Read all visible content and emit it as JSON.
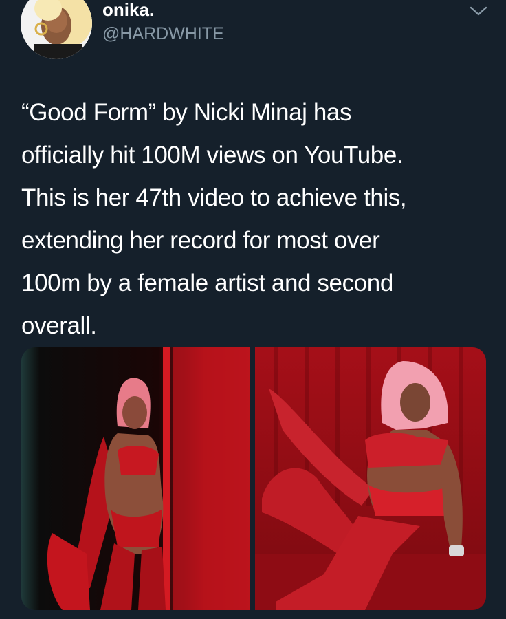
{
  "tweet": {
    "display_name": "onika.",
    "handle": "@HARDWHITE",
    "text": "“Good Form” by Nicki Minaj has\nofficially hit 100M views on YouTube.\nThis is her 47th video to achieve this,\nextending her record for most over\n100m by a female artist and second\noverall."
  },
  "icons": {
    "menu": "chevron-down-icon"
  },
  "colors": {
    "background": "#15202b",
    "text_primary": "#ffffff",
    "text_secondary": "#8899a6",
    "photo_red": "#b3111a"
  }
}
